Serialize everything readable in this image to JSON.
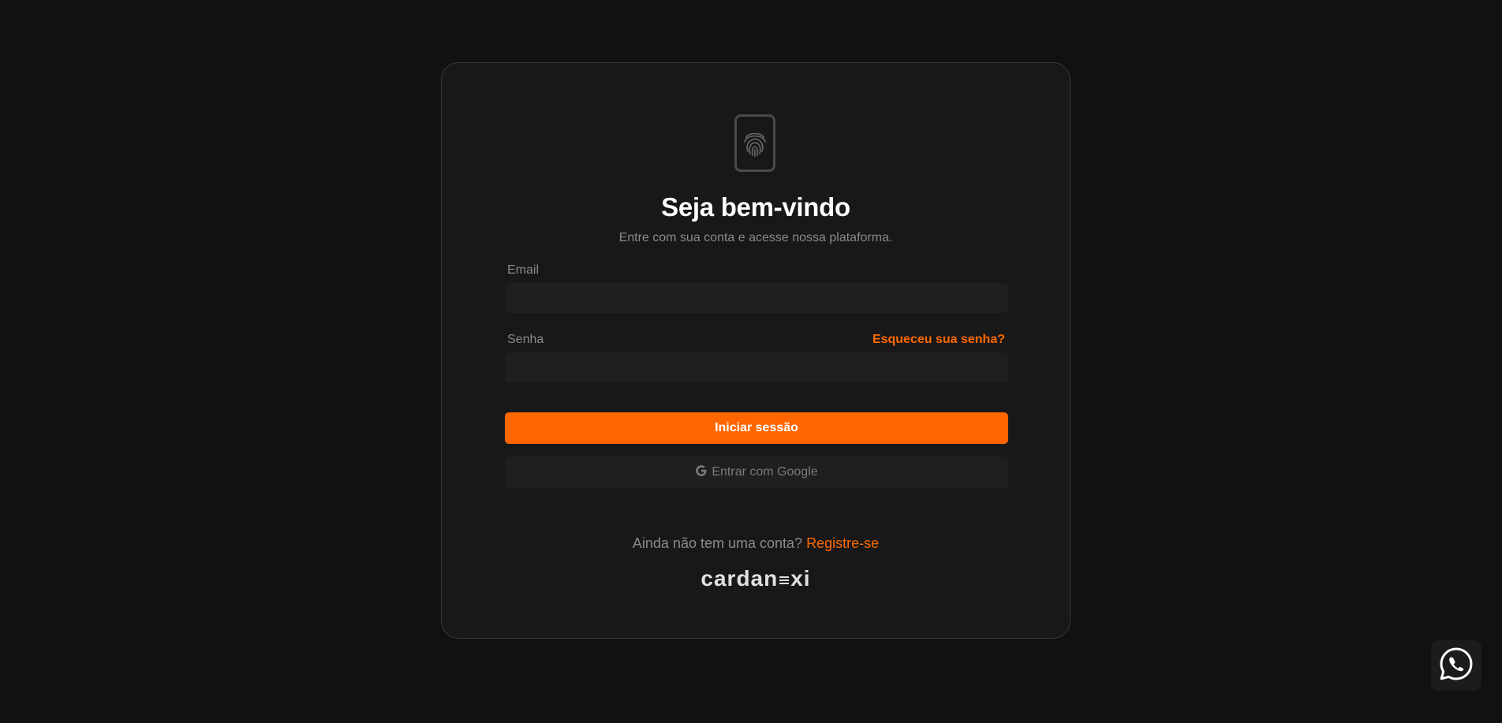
{
  "login": {
    "title": "Seja bem-vindo",
    "subtitle": "Entre com sua conta e acesse nossa plataforma.",
    "email_label": "Email",
    "email_value": "",
    "password_label": "Senha",
    "password_value": "",
    "forgot_password": "Esqueceu sua senha?",
    "submit_label": "Iniciar sessão",
    "google_label": "Entrar com Google",
    "register_prompt": "Ainda não tem uma conta?",
    "register_link": "Registre-se"
  },
  "brand": {
    "name_part1": "cardan",
    "name_part2": "xi"
  },
  "icons": {
    "logo": "fingerprint-icon",
    "google": "google-icon",
    "support": "whatsapp-icon"
  },
  "colors": {
    "background": "#111111",
    "card": "#181818",
    "accent": "#ff6600",
    "input": "#1f1f1f"
  }
}
